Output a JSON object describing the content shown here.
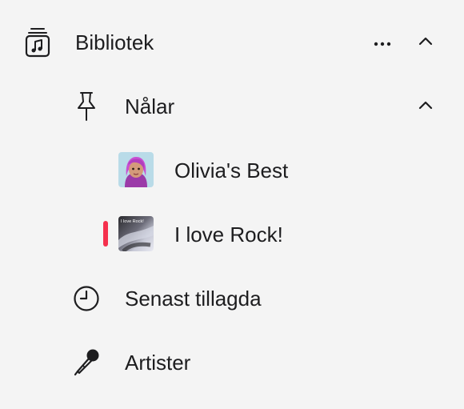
{
  "sidebar": {
    "library": {
      "label": "Bibliotek",
      "icon": "music-library-icon",
      "expanded": true
    },
    "pins": {
      "label": "Nålar",
      "icon": "pin-icon",
      "expanded": true,
      "items": [
        {
          "label": "Olivia's Best",
          "icon": "playlist-artwork-olivia"
        },
        {
          "label": "I love Rock!",
          "icon": "playlist-artwork-rock",
          "artwork_text": "I love Rock!",
          "active": true
        }
      ]
    },
    "recently_added": {
      "label": "Senast tillagda",
      "icon": "clock-icon"
    },
    "artists": {
      "label": "Artister",
      "icon": "microphone-icon"
    }
  },
  "colors": {
    "background": "#f4f4f4",
    "accent": "#f5304d",
    "text": "#1d1d1f"
  }
}
